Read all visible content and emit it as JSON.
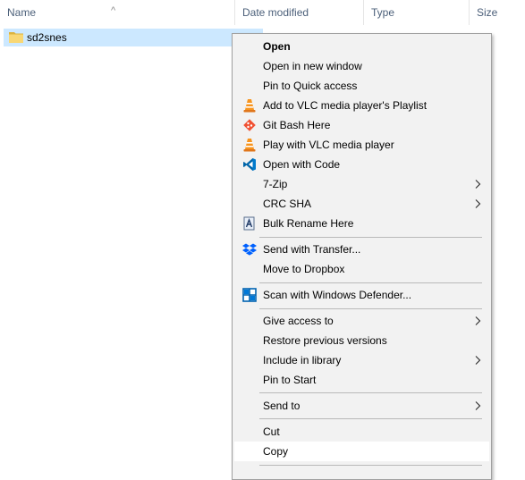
{
  "columns": {
    "name": "Name",
    "date_modified": "Date modified",
    "type": "Type",
    "size": "Size"
  },
  "file": {
    "name": "sd2snes",
    "icon": "folder-icon"
  },
  "context_menu": {
    "items": [
      {
        "label": "Open",
        "bold": true,
        "icon": ""
      },
      {
        "label": "Open in new window",
        "icon": ""
      },
      {
        "label": "Pin to Quick access",
        "icon": ""
      },
      {
        "label": "Add to VLC media player's Playlist",
        "icon": "vlc-icon"
      },
      {
        "label": "Git Bash Here",
        "icon": "git-icon"
      },
      {
        "label": "Play with VLC media player",
        "icon": "vlc-icon"
      },
      {
        "label": "Open with Code",
        "icon": "vscode-icon"
      },
      {
        "label": "7-Zip",
        "submenu": true
      },
      {
        "label": "CRC SHA",
        "submenu": true
      },
      {
        "label": "Bulk Rename Here",
        "icon": "bulk-rename-icon"
      },
      {
        "label": "Send with Transfer...",
        "icon": "dropbox-icon"
      },
      {
        "label": "Move to Dropbox",
        "icon": ""
      },
      {
        "label": "Scan with Windows Defender...",
        "icon": "defender-icon"
      },
      {
        "label": "Give access to",
        "submenu": true
      },
      {
        "label": "Restore previous versions"
      },
      {
        "label": "Include in library",
        "submenu": true
      },
      {
        "label": "Pin to Start"
      },
      {
        "label": "Send to",
        "submenu": true
      },
      {
        "label": "Cut"
      },
      {
        "label": "Copy",
        "highlighted": true
      }
    ]
  },
  "colors": {
    "selection": "#cce8ff",
    "menu_bg": "#f2f2f2",
    "header_text": "#4c607a"
  }
}
